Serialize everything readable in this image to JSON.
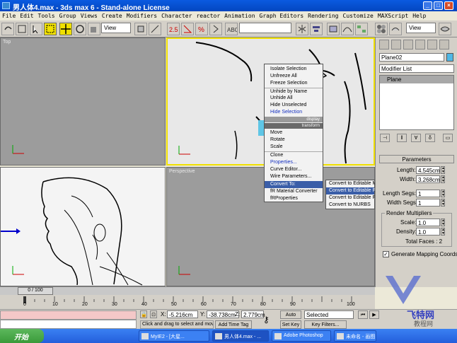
{
  "window": {
    "title": "男人体4.max - 3ds max 6 - Stand-alone License"
  },
  "menu": [
    "File",
    "Edit",
    "Tools",
    "Group",
    "Views",
    "Create",
    "Modifiers",
    "Character",
    "reactor",
    "Animation",
    "Graph Editors",
    "Rendering",
    "Customize",
    "MAXScript",
    "Help"
  ],
  "toolbar": {
    "ref_coord": "View",
    "ref_coord2": "View",
    "named_sel": ""
  },
  "viewports": {
    "top": "Top",
    "left": "",
    "perspective": "Perspective"
  },
  "context_menu": {
    "display_items": [
      "Isolate Selection",
      "Unfreeze All",
      "Freeze Selection",
      "Unhide by Name",
      "Unhide All",
      "Hide Unselected",
      "Hide Selection"
    ],
    "display_header": "display",
    "transform_header": "transform",
    "transform_items": [
      "Move",
      "Rotate",
      "Scale",
      "Clone",
      "Properties...",
      "Curve Editor...",
      "Wire Parameters...",
      "Convert To:",
      "fR Material Converter",
      "fRProperties"
    ]
  },
  "submenu": [
    "Convert to Editable Mesh",
    "Convert to Editable Poly",
    "Convert to Editable Patch",
    "Convert to NURBS"
  ],
  "command_panel": {
    "object_name": "Plane02",
    "object_color": "#4fb8e6",
    "modifier_list": "Modifier List",
    "stack_item": "Plane",
    "rollout_title": "Parameters",
    "length_label": "Length:",
    "length_value": "4.545cm",
    "width_label": "Width:",
    "width_value": "3.268cm",
    "length_segs_label": "Length Segs:",
    "length_segs_value": "1",
    "width_segs_label": "Width Segs:",
    "width_segs_value": "1",
    "render_multipliers": "Render Multipliers",
    "scale_label": "Scale:",
    "scale_value": "1.0",
    "density_label": "Density:",
    "density_value": "1.0",
    "total_faces": "Total Faces : 2",
    "gen_mapping": "Generate Mapping Coords."
  },
  "timeline": {
    "frame": "0 / 100",
    "ticks": [
      "0",
      "10",
      "20",
      "30",
      "40",
      "50",
      "60",
      "70",
      "80",
      "90",
      "100"
    ]
  },
  "status": {
    "x_label": "X:",
    "x_value": "-5.216cm",
    "y_label": "Y:",
    "y_value": "-38.738cm",
    "z_label": "Z:",
    "z_value": "2.779cm",
    "prompt": "Click and drag to select and move",
    "add_time_tag": "Add Time Tag",
    "auto_key": "Auto Key",
    "selected": "Selected",
    "set_key": "Set Key",
    "key_filters": "Key Filters..."
  },
  "taskbar": {
    "start": "开始",
    "tasks": [
      "MyIE2 - [大星...",
      "男人体4.max - ...",
      "Adobe Photoshop",
      "未命名 - 画图"
    ]
  },
  "watermark": {
    "brand": "飞特网",
    "site": "教程网"
  }
}
